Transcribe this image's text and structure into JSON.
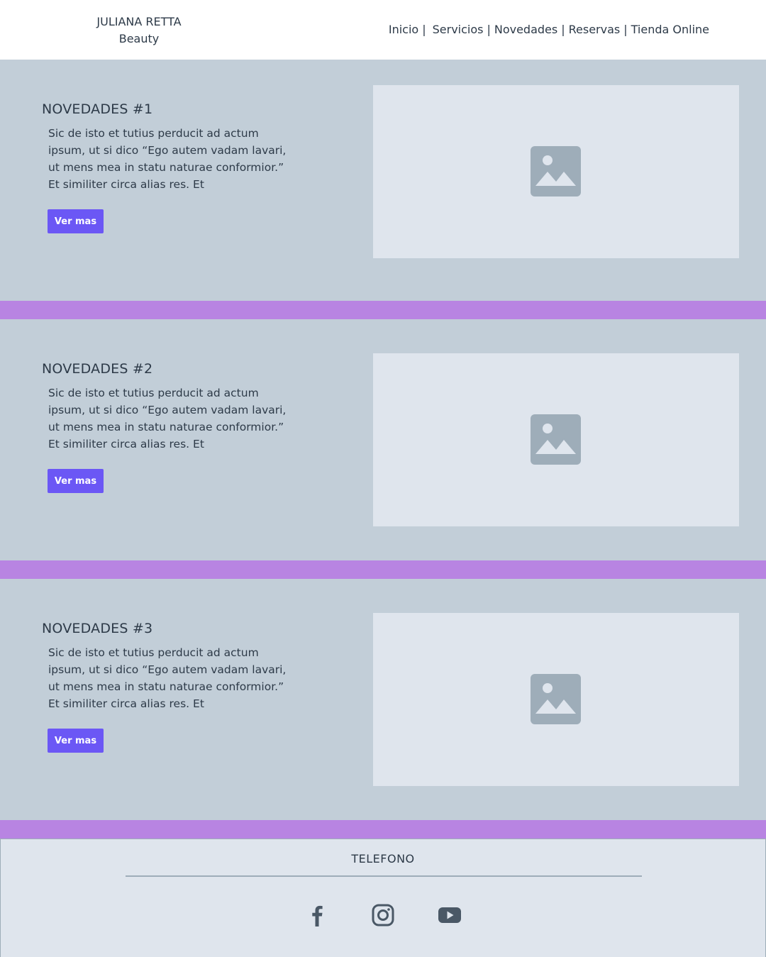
{
  "brand": {
    "line1": "JULIANA RETTA",
    "line2": "Beauty"
  },
  "nav": {
    "items": [
      {
        "label": "Inicio"
      },
      {
        "label": "Servicios"
      },
      {
        "label": "Novedades"
      },
      {
        "label": "Reservas"
      },
      {
        "label": "Tienda Online"
      }
    ],
    "separator": "|"
  },
  "posts": [
    {
      "title": "NOVEDADES #1",
      "text": "Sic de isto et tutius perducit ad actum ipsum, ut si dico “Ego autem vadam lavari, ut mens mea in statu naturae conformior.” Et similiter circa alias res. Et",
      "button": "Ver mas",
      "image_icon": "image-placeholder-icon"
    },
    {
      "title": "NOVEDADES #2",
      "text": "Sic de isto et tutius perducit ad actum ipsum, ut si dico “Ego autem vadam lavari, ut mens mea in statu naturae conformior.” Et similiter circa alias res. Et",
      "button": "Ver mas",
      "image_icon": "image-placeholder-icon"
    },
    {
      "title": "NOVEDADES #3",
      "text": "Sic de isto et tutius perducit ad actum ipsum, ut si dico “Ego autem vadam lavari, ut mens mea in statu naturae conformior.” Et similiter circa alias res. Et",
      "button": "Ver mas",
      "image_icon": "image-placeholder-icon"
    }
  ],
  "footer": {
    "phone_label": "TELEFONO",
    "social": [
      {
        "icon": "facebook-icon"
      },
      {
        "icon": "instagram-icon"
      },
      {
        "icon": "youtube-icon"
      }
    ]
  },
  "colors": {
    "section_bg": "#c2ced8",
    "divider": "#b884e2",
    "button": "#6b57f5",
    "image_bg": "#dfe5ed",
    "icon_gray": "#9eadb9",
    "text": "#2d3a48"
  }
}
